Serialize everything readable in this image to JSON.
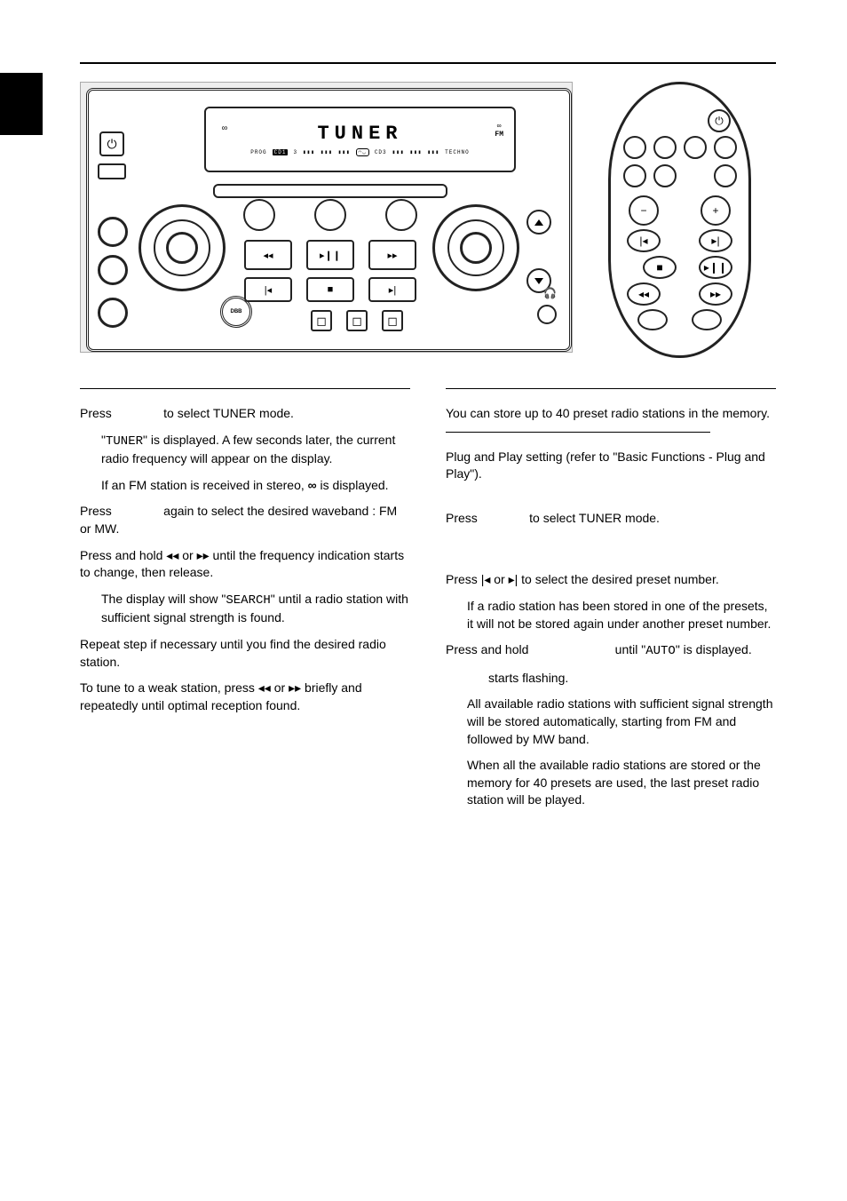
{
  "display": {
    "main": "TUNER",
    "row2": {
      "prog": "PROG",
      "cd1": "CD1",
      "num": "3",
      "cd3": "CD3",
      "aux": "TECHNO"
    },
    "side": {
      "stereo_icon": "∞",
      "fm": "FM"
    }
  },
  "device": {
    "power_icon": "⏻",
    "dbb": "DBB",
    "prev": "◂◂",
    "playpause": "▸❙❙",
    "next": "▸▸",
    "skipprev": "|◂",
    "stop": "■",
    "skipnext": "▸|",
    "updown_up": "△",
    "updown_down": "▽",
    "headphone_icon": "🎧",
    "tray_stop1": "◻",
    "tray_stop2": "◻",
    "tray_stop3": "◻"
  },
  "remote": {
    "power_icon": "⏻",
    "minus": "−",
    "plus": "+",
    "prev": "|◂",
    "next": "▸|",
    "stop": "■",
    "playpause": "▸❙❙",
    "rew": "◂◂",
    "ff": "▸▸"
  },
  "left": {
    "p1a": "Press ",
    "p1b": " to select TUNER mode.",
    "p1c_a": "\"",
    "p1c_seg": "TUNER",
    "p1c_b": "\" is displayed.  A few seconds later, the current radio frequency will appear on the display.",
    "p1d_a": "If an FM station is received in stereo, ",
    "p1d_sym": "∞",
    "p1d_b": " is displayed.",
    "p2a": "Press ",
    "p2b": " again to select the desired waveband : FM or MW.",
    "p3a": "Press and hold ",
    "p3_rew": "◂◂",
    "p3_or": " or ",
    "p3_ff": "▸▸",
    "p3b": " until the frequency indication starts to change, then release.",
    "p3c_a": "The display will show \"",
    "p3c_seg": "SEARCH",
    "p3c_b": "\" until a radio station with sufficient signal strength is found.",
    "p4": "Repeat step    if necessary until you find the desired radio station.",
    "p5a": "To tune to a weak station, press ",
    "p5_rew": "◂◂",
    "p5_or": " or ",
    "p5_ff": "▸▸",
    "p5b": " briefly and repeatedly until optimal reception found."
  },
  "right": {
    "intro": "You can store up to 40 preset radio stations in the memory.",
    "r1": "Plug and Play setting (refer to \"Basic Functions - Plug and Play\").",
    "r2a": "Press ",
    "r2b": " to select TUNER mode.",
    "r3a": "Press ",
    "r3_prev": "|◂",
    "r3_or": " or ",
    "r3_next": "▸|",
    "r3b": " to select the desired preset number.",
    "r3c": "If a radio station has been stored in one of the presets, it will not be stored again under another preset number.",
    "r4a": "Press and hold ",
    "r4b": " until \"",
    "r4_seg": "AUTO",
    "r4c": "\" is displayed.",
    "r4d": " starts flashing.",
    "r4e": "All available radio stations with sufficient signal strength will be stored automatically, starting from FM and followed by MW band.",
    "r4f": "When all the available radio stations are stored or the memory for 40 presets are used, the last preset radio station will be played."
  }
}
